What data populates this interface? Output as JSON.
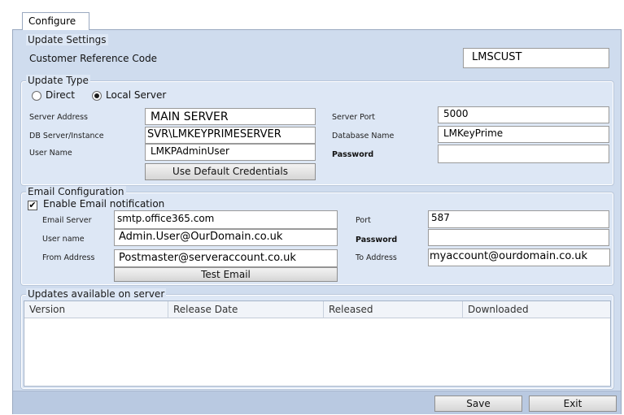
{
  "tab": {
    "label": "Configure"
  },
  "update_settings": {
    "title": "Update Settings",
    "customer_ref_label": "Customer Reference Code",
    "customer_ref_value": "LMSCUST"
  },
  "update_type": {
    "title": "Update Type",
    "direct_label": "Direct",
    "local_label": "Local Server",
    "selected": "Local Server",
    "server_address_label": "Server Address",
    "server_address_value": "MAIN SERVER",
    "db_server_label": "DB Server/Instance",
    "db_server_value": "SVR\\LMKEYPRIMESERVER",
    "user_name_label": "User Name",
    "user_name_value": "LMKPAdminUser",
    "server_port_label": "Server Port",
    "server_port_value": "5000",
    "database_name_label": "Database Name",
    "database_name_value": "LMKeyPrime",
    "password_label": "Password",
    "password_value": "",
    "default_credentials_button": "Use Default Credentials"
  },
  "email_config": {
    "title": "Email Configuration",
    "enable_label": "Enable Email notification",
    "enable_checked": true,
    "check_glyph": "✔",
    "email_server_label": "Email Server",
    "email_server_value": "smtp.office365.com",
    "user_name_label": "User name",
    "user_name_value": "Admin.User@OurDomain.co.uk",
    "from_address_label": "From Address",
    "from_address_value": "Postmaster@serveraccount.co.uk",
    "port_label": "Port",
    "port_value": "587",
    "password_label": "Password",
    "password_value": "",
    "to_address_label": "To Address",
    "to_address_value": "myaccount@ourdomain.co.uk",
    "test_email_button": "Test Email"
  },
  "updates": {
    "title": "Updates available on server",
    "columns": [
      "Version",
      "Release Date",
      "Released",
      "Downloaded"
    ],
    "rows": []
  },
  "footer": {
    "save_button": "Save",
    "exit_button": "Exit"
  },
  "colors": {
    "window_bg": "#cfdcee",
    "group_bg": "#dde7f5",
    "status_bar": "#b9c9e1"
  }
}
